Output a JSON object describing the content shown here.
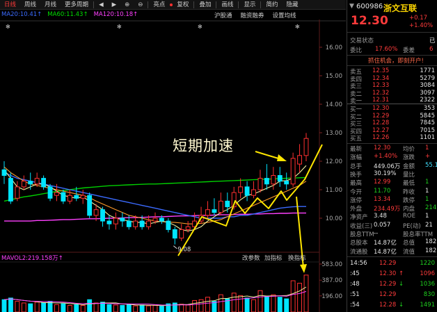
{
  "toolbar": {
    "items": [
      "日线",
      "周线",
      "月线",
      "更多周期",
      "◀",
      "▶",
      "⊕",
      "⊖",
      "亮点",
      "复权",
      "叠加",
      "画线",
      "显示",
      "简约",
      "隐藏"
    ],
    "active": 0
  },
  "ma_legend": [
    {
      "label": "MA20:10.41↑",
      "color": "#3b6bff"
    },
    {
      "label": "MA60:11.43↑",
      "color": "#00e000"
    },
    {
      "label": "MA120:10.18↑",
      "color": "#ff40ff"
    }
  ],
  "ma_right": [
    "沪股通",
    "融资融券",
    "设置均线"
  ],
  "y_axis": {
    "price_ticks": [
      "16.00",
      "15.00",
      "14.00",
      "13.00",
      "12.00",
      "11.00",
      "10.00"
    ],
    "vol_ticks": [
      "583.00",
      "387.00",
      "196.00"
    ]
  },
  "chart_data": {
    "type": "candlestick",
    "price_range": [
      9.0,
      16.0
    ],
    "candles": [
      {
        "o": 11.7,
        "c": 11.5,
        "h": 12.0,
        "l": 11.2,
        "v": 150
      },
      {
        "o": 11.4,
        "c": 10.6,
        "h": 11.6,
        "l": 10.5,
        "v": 170
      },
      {
        "o": 10.7,
        "c": 11.1,
        "h": 11.3,
        "l": 10.6,
        "v": 130
      },
      {
        "o": 11.1,
        "c": 11.3,
        "h": 11.5,
        "l": 11.0,
        "v": 110
      },
      {
        "o": 11.3,
        "c": 11.2,
        "h": 11.6,
        "l": 11.0,
        "v": 100
      },
      {
        "o": 11.2,
        "c": 11.4,
        "h": 11.6,
        "l": 11.1,
        "v": 120
      },
      {
        "o": 11.4,
        "c": 11.1,
        "h": 11.5,
        "l": 11.0,
        "v": 110
      },
      {
        "o": 11.1,
        "c": 10.7,
        "h": 11.2,
        "l": 10.6,
        "v": 130
      },
      {
        "o": 10.8,
        "c": 10.9,
        "h": 11.2,
        "l": 10.6,
        "v": 90
      },
      {
        "o": 10.9,
        "c": 10.6,
        "h": 11.0,
        "l": 10.5,
        "v": 100
      },
      {
        "o": 10.6,
        "c": 10.8,
        "h": 11.0,
        "l": 10.5,
        "v": 80
      },
      {
        "o": 10.8,
        "c": 10.7,
        "h": 11.1,
        "l": 10.6,
        "v": 90
      },
      {
        "o": 10.7,
        "c": 10.8,
        "h": 11.0,
        "l": 10.5,
        "v": 80
      },
      {
        "o": 10.8,
        "c": 10.1,
        "h": 10.9,
        "l": 10.0,
        "v": 150
      },
      {
        "o": 10.1,
        "c": 10.3,
        "h": 10.5,
        "l": 9.9,
        "v": 110
      },
      {
        "o": 10.3,
        "c": 9.9,
        "h": 10.4,
        "l": 9.7,
        "v": 120
      },
      {
        "o": 9.9,
        "c": 9.8,
        "h": 10.1,
        "l": 9.6,
        "v": 90
      },
      {
        "o": 9.8,
        "c": 10.0,
        "h": 10.2,
        "l": 9.6,
        "v": 85
      },
      {
        "o": 10.0,
        "c": 9.9,
        "h": 10.2,
        "l": 9.7,
        "v": 80
      },
      {
        "o": 9.9,
        "c": 9.7,
        "h": 10.1,
        "l": 9.6,
        "v": 95
      },
      {
        "o": 9.7,
        "c": 9.9,
        "h": 10.1,
        "l": 9.6,
        "v": 75
      },
      {
        "o": 9.9,
        "c": 9.7,
        "h": 10.1,
        "l": 9.6,
        "v": 85
      },
      {
        "o": 9.7,
        "c": 9.9,
        "h": 10.1,
        "l": 9.6,
        "v": 75
      },
      {
        "o": 9.9,
        "c": 10.0,
        "h": 10.2,
        "l": 9.8,
        "v": 80
      },
      {
        "o": 10.0,
        "c": 9.9,
        "h": 10.1,
        "l": 9.8,
        "v": 70
      },
      {
        "o": 9.9,
        "c": 9.6,
        "h": 10.0,
        "l": 9.5,
        "v": 100
      },
      {
        "o": 9.6,
        "c": 9.3,
        "h": 9.7,
        "l": 9.08,
        "v": 110
      },
      {
        "o": 9.3,
        "c": 9.6,
        "h": 9.8,
        "l": 9.2,
        "v": 95
      },
      {
        "o": 9.6,
        "c": 9.7,
        "h": 9.9,
        "l": 9.5,
        "v": 85
      },
      {
        "o": 9.7,
        "c": 9.9,
        "h": 10.2,
        "l": 9.6,
        "v": 140
      },
      {
        "o": 9.9,
        "c": 10.1,
        "h": 10.4,
        "l": 9.8,
        "v": 150
      },
      {
        "o": 10.1,
        "c": 10.3,
        "h": 10.6,
        "l": 10.0,
        "v": 180
      },
      {
        "o": 10.3,
        "c": 10.2,
        "h": 10.7,
        "l": 10.1,
        "v": 130
      },
      {
        "o": 10.2,
        "c": 10.6,
        "h": 10.9,
        "l": 10.1,
        "v": 210
      },
      {
        "o": 10.6,
        "c": 10.4,
        "h": 10.9,
        "l": 10.2,
        "v": 160
      },
      {
        "o": 10.4,
        "c": 10.9,
        "h": 11.1,
        "l": 10.3,
        "v": 230
      },
      {
        "o": 10.9,
        "c": 11.1,
        "h": 11.4,
        "l": 10.7,
        "v": 200
      },
      {
        "o": 11.1,
        "c": 10.8,
        "h": 11.3,
        "l": 10.6,
        "v": 170
      },
      {
        "o": 10.8,
        "c": 11.0,
        "h": 11.3,
        "l": 10.7,
        "v": 150
      },
      {
        "o": 11.0,
        "c": 11.4,
        "h": 11.7,
        "l": 10.9,
        "v": 260
      },
      {
        "o": 11.4,
        "c": 11.2,
        "h": 11.9,
        "l": 11.0,
        "v": 190
      },
      {
        "o": 11.2,
        "c": 11.5,
        "h": 11.8,
        "l": 11.0,
        "v": 210
      },
      {
        "o": 11.5,
        "c": 11.3,
        "h": 11.8,
        "l": 11.1,
        "v": 180
      },
      {
        "o": 11.3,
        "c": 11.2,
        "h": 11.6,
        "l": 11.0,
        "v": 160
      },
      {
        "o": 11.2,
        "c": 12.1,
        "h": 12.3,
        "l": 11.1,
        "v": 380
      },
      {
        "o": 11.9,
        "c": 12.2,
        "h": 12.6,
        "l": 11.6,
        "v": 350
      },
      {
        "o": 12.2,
        "c": 12.8,
        "h": 12.99,
        "l": 12.0,
        "v": 449
      }
    ],
    "low_marker": "9.08"
  },
  "ma_lines": {
    "ma20": [
      11.6,
      11.5,
      11.4,
      11.35,
      11.3,
      11.25,
      11.2,
      11.15,
      11.1,
      11.05,
      11.0,
      10.95,
      10.9,
      10.85,
      10.8,
      10.75,
      10.7,
      10.65,
      10.6,
      10.55,
      10.5,
      10.45,
      10.4,
      10.35,
      10.3,
      10.25,
      10.2,
      10.15,
      10.1,
      10.05,
      10.0,
      10.0,
      10.0,
      10.0,
      10.05,
      10.05,
      10.1,
      10.1,
      10.15,
      10.2,
      10.25,
      10.3,
      10.35,
      10.38,
      10.4,
      10.41,
      10.41
    ],
    "ma60": [
      10.6,
      10.65,
      10.7,
      10.75,
      10.78,
      10.82,
      10.86,
      10.9,
      10.94,
      10.97,
      11.0,
      11.03,
      11.06,
      11.08,
      11.1,
      11.12,
      11.14,
      11.15,
      11.16,
      11.17,
      11.18,
      11.19,
      11.2,
      11.2,
      11.21,
      11.22,
      11.23,
      11.24,
      11.25,
      11.26,
      11.27,
      11.28,
      11.29,
      11.3,
      11.31,
      11.32,
      11.33,
      11.34,
      11.35,
      11.36,
      11.37,
      11.38,
      11.39,
      11.4,
      11.41,
      11.42,
      11.43
    ],
    "ma120": [
      9.9,
      9.9,
      9.9,
      9.9,
      9.9,
      9.92,
      9.92,
      9.93,
      9.94,
      9.95,
      9.95,
      9.96,
      9.97,
      9.98,
      9.98,
      9.99,
      10.0,
      10.0,
      10.01,
      10.02,
      10.02,
      10.03,
      10.04,
      10.05,
      10.05,
      10.06,
      10.07,
      10.08,
      10.08,
      10.09,
      10.1,
      10.1,
      10.11,
      10.12,
      10.12,
      10.13,
      10.14,
      10.14,
      10.15,
      10.15,
      10.16,
      10.16,
      10.17,
      10.17,
      10.18,
      10.18,
      10.18
    ],
    "ma5": [
      11.7,
      11.4,
      11.1,
      11.0,
      11.1,
      11.2,
      11.2,
      11.1,
      10.95,
      10.8,
      10.75,
      10.7,
      10.75,
      10.6,
      10.45,
      10.3,
      10.1,
      10.0,
      9.95,
      9.9,
      9.85,
      9.85,
      9.8,
      9.85,
      9.9,
      9.85,
      9.75,
      9.6,
      9.55,
      9.6,
      9.7,
      9.9,
      10.05,
      10.2,
      10.3,
      10.45,
      10.65,
      10.8,
      10.85,
      10.95,
      11.05,
      11.15,
      11.3,
      11.32,
      11.4,
      11.6,
      11.85
    ],
    "ma10": [
      11.8,
      11.6,
      11.45,
      11.3,
      11.2,
      11.15,
      11.1,
      11.05,
      11.0,
      10.95,
      10.9,
      10.85,
      10.8,
      10.72,
      10.6,
      10.5,
      10.4,
      10.3,
      10.2,
      10.1,
      10.05,
      10.0,
      9.95,
      9.9,
      9.88,
      9.86,
      9.85,
      9.83,
      9.8,
      9.8,
      9.82,
      9.85,
      9.9,
      9.95,
      10.05,
      10.15,
      10.25,
      10.35,
      10.45,
      10.55,
      10.65,
      10.75,
      10.85,
      10.95,
      11.05,
      11.15,
      11.3
    ]
  },
  "annotation": "短期加速",
  "vol_header": {
    "label": "MAVOL2:219.158万↑",
    "links": [
      "改参数",
      "加指标",
      "换指标"
    ]
  },
  "quote": {
    "code": "600986",
    "name": "浙文互联",
    "price": "12.30",
    "change": "+0.17",
    "change_pct": "+1.40%",
    "status_label": "交易状态",
    "status_value": "已",
    "wb_label": "委比",
    "wb_value": "17.60%",
    "wc_label": "委差",
    "wc_value": "6",
    "promo": "抓住机会，即刻开户!",
    "asks": [
      {
        "label": "卖五",
        "price": "12.35",
        "vol": "1771"
      },
      {
        "label": "卖四",
        "price": "12.34",
        "vol": "5279"
      },
      {
        "label": "卖三",
        "price": "12.33",
        "vol": "3084"
      },
      {
        "label": "卖二",
        "price": "12.32",
        "vol": "3097"
      },
      {
        "label": "卖一",
        "price": "12.31",
        "vol": "2322"
      }
    ],
    "bids": [
      {
        "label": "买一",
        "price": "12.30",
        "vol": "353"
      },
      {
        "label": "买二",
        "price": "12.29",
        "vol": "5845"
      },
      {
        "label": "买三",
        "price": "12.28",
        "vol": "7845"
      },
      {
        "label": "买四",
        "price": "12.27",
        "vol": "7015"
      },
      {
        "label": "买五",
        "price": "12.26",
        "vol": "1101"
      }
    ],
    "stats": [
      {
        "l1": "最新",
        "v1": "12.30",
        "c1": "red",
        "l2": "均价",
        "v2": "1",
        "c2": "red"
      },
      {
        "l1": "涨幅",
        "v1": "+1.40%",
        "c1": "red",
        "l2": "涨跌",
        "v2": "+",
        "c2": "red"
      },
      {
        "l1": "总手",
        "v1": "449.06万",
        "c1": "white",
        "l2": "金额",
        "v2": "55.1",
        "c2": "cyan"
      },
      {
        "l1": "换手",
        "v1": "30.19%",
        "c1": "white",
        "l2": "量比",
        "v2": "",
        "c2": "white"
      },
      {
        "l1": "最高",
        "v1": "12.99",
        "c1": "red",
        "l2": "最低",
        "v2": "1",
        "c2": "green"
      },
      {
        "l1": "今开",
        "v1": "11.70",
        "c1": "green",
        "l2": "昨收",
        "v2": "1",
        "c2": "white"
      },
      {
        "l1": "涨停",
        "v1": "13.34",
        "c1": "red",
        "l2": "跌停",
        "v2": "1",
        "c2": "green"
      },
      {
        "l1": "外盘",
        "v1": "234.49万",
        "c1": "red",
        "l2": "内盘",
        "v2": "214.",
        "c2": "green"
      },
      {
        "l1": "净资产",
        "v1": "3.48",
        "c1": "white",
        "l2": "ROE",
        "v2": "1",
        "c2": "white"
      },
      {
        "l1": "收益(三)",
        "v1": "0.057",
        "c1": "white",
        "l2": "PE(动)",
        "v2": "21",
        "c2": "white"
      },
      {
        "l1": "股息TTM",
        "v1": "--",
        "c1": "white",
        "l2": "股息率TTM",
        "v2": "",
        "c2": "white"
      },
      {
        "l1": "总股本",
        "v1": "14.87亿",
        "c1": "white",
        "l2": "总值",
        "v2": "182",
        "c2": "white"
      },
      {
        "l1": "流通股",
        "v1": "14.87亿",
        "c1": "white",
        "l2": "流值",
        "v2": "182",
        "c2": "white"
      }
    ],
    "ticks": [
      {
        "t": "14:56",
        "p": "12.29",
        "v": "1220",
        "vc": "green",
        "a": ""
      },
      {
        "t": ":45",
        "p": "12.30",
        "v": "1096",
        "vc": "red",
        "a": "↑"
      },
      {
        "t": ":48",
        "p": "12.29",
        "v": "1036",
        "vc": "green",
        "a": "↓"
      },
      {
        "t": ":51",
        "p": "12.29",
        "v": "830",
        "vc": "green",
        "a": ""
      },
      {
        "t": ":54",
        "p": "12.28",
        "v": "1491",
        "vc": "green",
        "a": "↓"
      }
    ]
  }
}
